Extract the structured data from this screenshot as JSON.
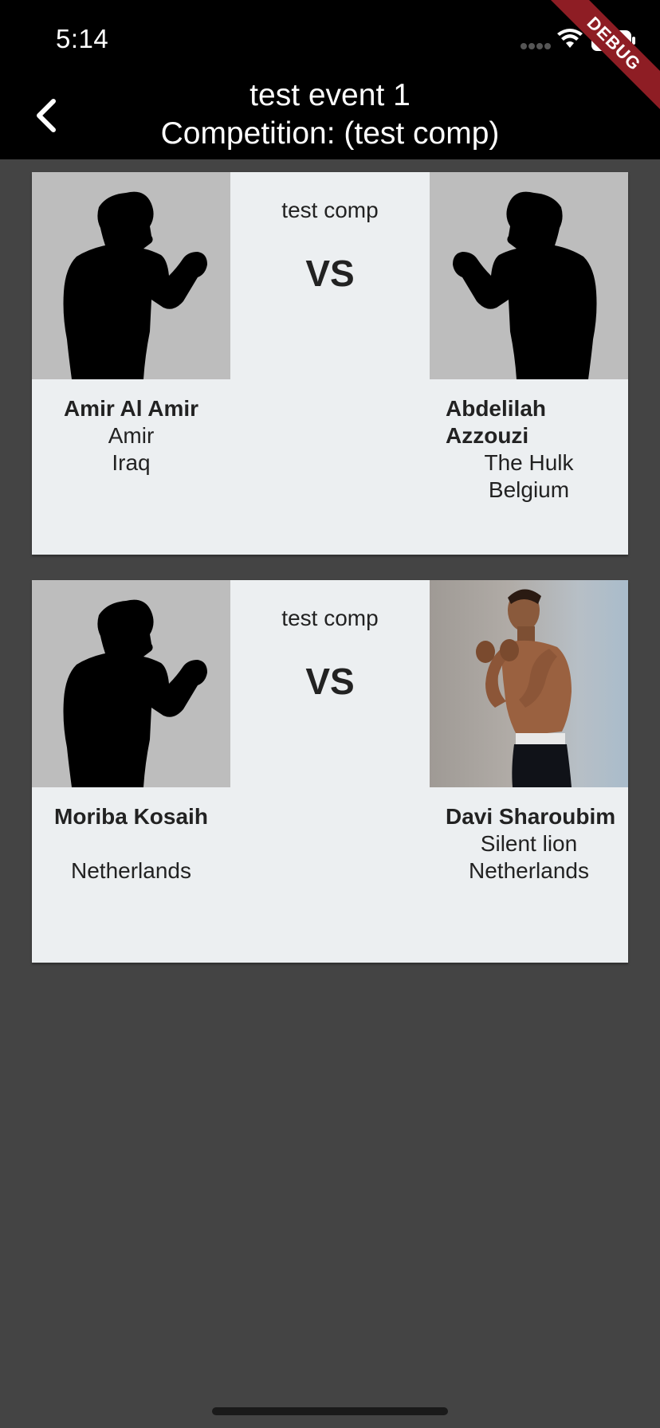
{
  "status_bar": {
    "time": "5:14",
    "icons": [
      "signal-icon",
      "wifi-icon",
      "battery-icon"
    ]
  },
  "app_bar": {
    "title_line1": "test event 1",
    "title_line2": "Competition: (test comp)",
    "back_icon": "chevron-left-icon",
    "debug_banner": "DEBUG"
  },
  "colors": {
    "background": "#444444",
    "card": "#eceff1",
    "app_bar": "#000000",
    "photo_placeholder": "#bdbdbd",
    "debug_ribbon": "#8e1d24"
  },
  "matches": [
    {
      "competition": "test comp",
      "vs": "VS",
      "left": {
        "name": "Amir Al Amir",
        "nickname": "Amir",
        "country": "Iraq",
        "photo": "silhouette"
      },
      "right": {
        "name": "Abdelilah Azzouzi",
        "nickname": "The Hulk",
        "country": "Belgium",
        "photo": "silhouette"
      }
    },
    {
      "competition": "test comp",
      "vs": "VS",
      "left": {
        "name": "Moriba Kosaih",
        "nickname": "",
        "country": "Netherlands",
        "photo": "silhouette"
      },
      "right": {
        "name": "Davi Sharoubim",
        "nickname": "Silent lion",
        "country": "Netherlands",
        "photo": "photo"
      }
    }
  ]
}
